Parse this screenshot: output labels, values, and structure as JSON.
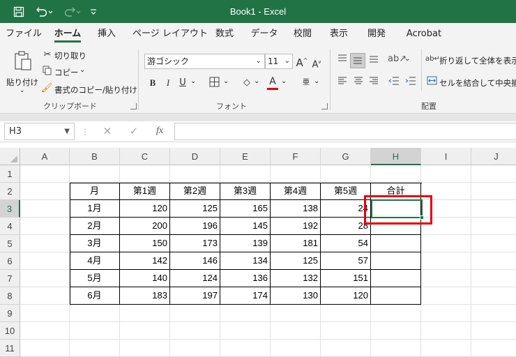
{
  "titlebar": {
    "title": "Book1  -  Excel",
    "save_icon": "save-icon",
    "undo_icon": "undo-icon",
    "redo_icon": "redo-icon",
    "customize_icon": "customize-quick-access-icon"
  },
  "tabs": [
    "ファイル",
    "ホーム",
    "挿入",
    "ページ レイアウト",
    "数式",
    "データ",
    "校閲",
    "表示",
    "開発",
    "Acrobat"
  ],
  "active_tab": "ホーム",
  "ribbon": {
    "clipboard": {
      "paste": "貼り付け",
      "cut": "切り取り",
      "copy": "コピー",
      "format_painter": "書式のコピー/貼り付け",
      "label": "クリップボード"
    },
    "font": {
      "font_name": "游ゴシック",
      "font_size": "11",
      "bold": "B",
      "italic": "I",
      "underline": "U",
      "font_color_letter": "A",
      "phonetic": "亜",
      "label": "フォント"
    },
    "alignment": {
      "wrap_text": "折り返して全体を表示す",
      "merge_center": "セルを結合して中央揃え",
      "label": "配置"
    },
    "accent_color": "#217346",
    "font_color_bar": "#e00000"
  },
  "formula_bar": {
    "name_box": "H3",
    "fx": "fx",
    "value": ""
  },
  "grid": {
    "columns": [
      "A",
      "B",
      "C",
      "D",
      "E",
      "F",
      "G",
      "H",
      "I",
      "J"
    ],
    "rows": [
      "1",
      "2",
      "3",
      "4",
      "5",
      "6",
      "7",
      "8",
      "9",
      "10",
      "11"
    ],
    "selected_cell": "H3",
    "table": {
      "header": [
        "月",
        "第1週",
        "第2週",
        "第3週",
        "第4週",
        "第5週",
        "合計"
      ],
      "rows": [
        [
          "1月",
          "120",
          "125",
          "165",
          "138",
          "24",
          ""
        ],
        [
          "2月",
          "200",
          "196",
          "145",
          "192",
          "28",
          ""
        ],
        [
          "3月",
          "150",
          "173",
          "139",
          "181",
          "54",
          ""
        ],
        [
          "4月",
          "142",
          "146",
          "134",
          "125",
          "57",
          ""
        ],
        [
          "5月",
          "140",
          "124",
          "136",
          "132",
          "151",
          ""
        ],
        [
          "6月",
          "183",
          "197",
          "174",
          "130",
          "120",
          ""
        ]
      ]
    },
    "highlight_color": "#e0000f"
  }
}
